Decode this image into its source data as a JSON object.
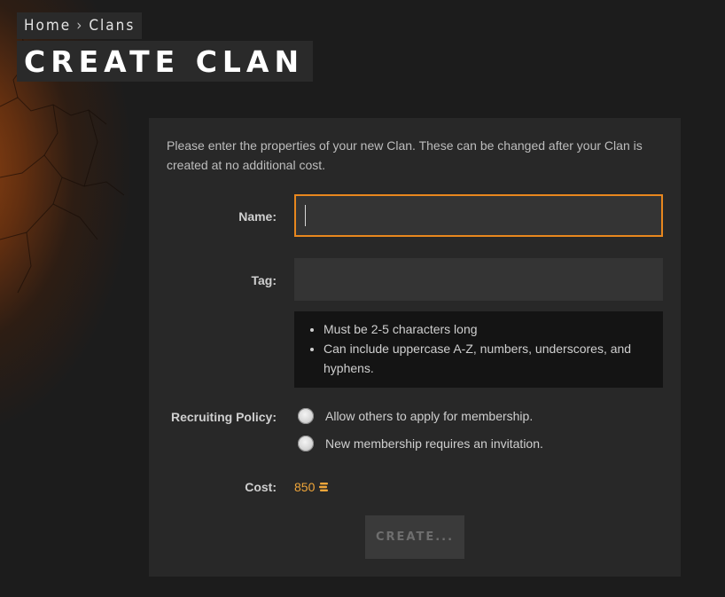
{
  "breadcrumb": {
    "home": "Home",
    "separator": "›",
    "current": "Clans"
  },
  "page_title": "CREATE CLAN",
  "form": {
    "intro": "Please enter the properties of your new Clan. These can be changed after your Clan is created at no additional cost.",
    "name_label": "Name:",
    "name_value": "",
    "tag_label": "Tag:",
    "tag_value": "",
    "tag_hints": [
      "Must be 2-5 characters long",
      "Can include uppercase A-Z, numbers, underscores, and hyphens."
    ],
    "recruiting_label": "Recruiting Policy:",
    "recruiting_options": [
      "Allow others to apply for membership.",
      "New membership requires an invitation."
    ],
    "cost_label": "Cost:",
    "cost_value": "850",
    "cost_icon": "coin-stack-icon",
    "create_button": "CREATE..."
  },
  "colors": {
    "accent": "#e8871e",
    "cost": "#f0a63a",
    "panel": "#282828",
    "background": "#1c1c1c"
  }
}
